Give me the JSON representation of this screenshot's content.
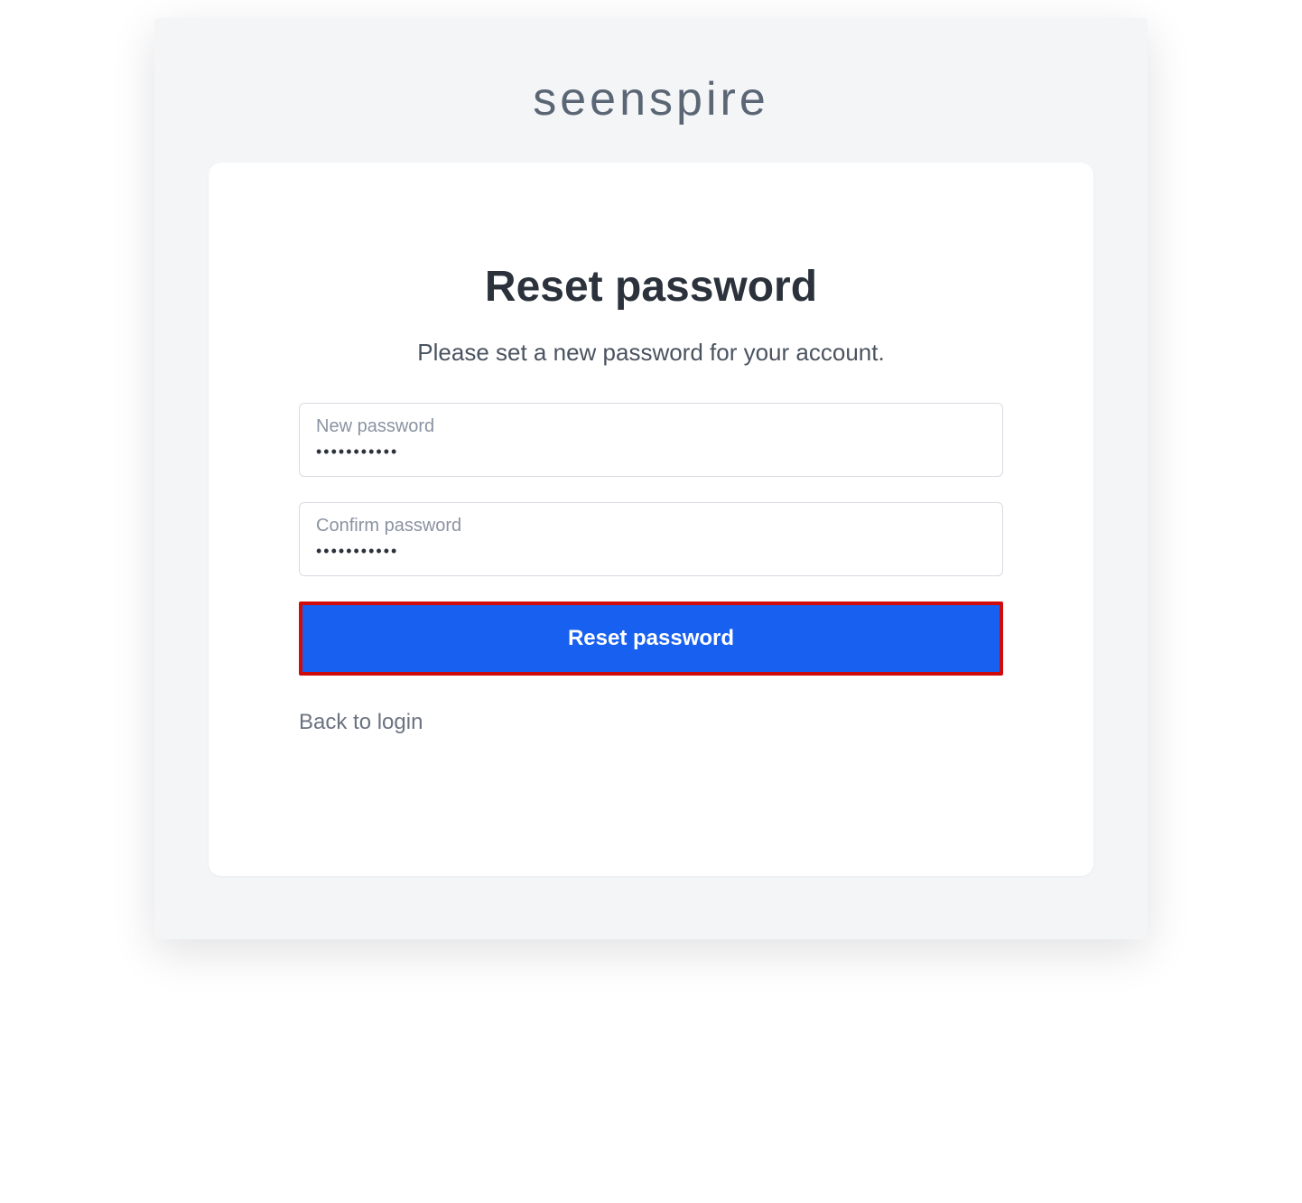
{
  "brand": "seenspire",
  "heading": "Reset password",
  "subtitle": "Please set a new password for your account.",
  "fields": {
    "new_password": {
      "label": "New password",
      "value": "•••••••••••"
    },
    "confirm_password": {
      "label": "Confirm password",
      "value": "•••••••••••"
    }
  },
  "submit_label": "Reset password",
  "back_link_label": "Back to login"
}
